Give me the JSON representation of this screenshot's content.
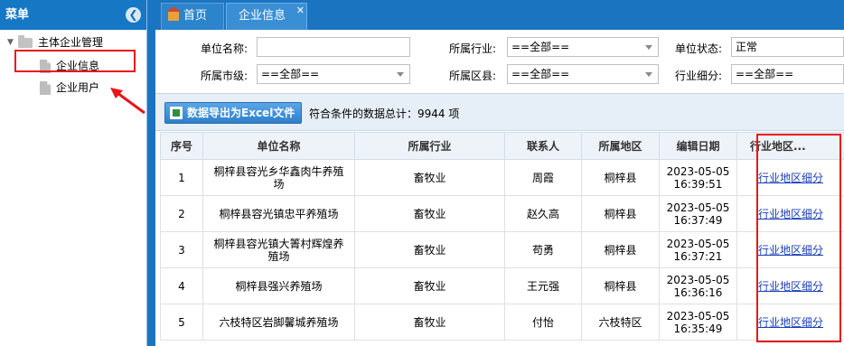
{
  "sidebar": {
    "title": "菜单",
    "collapse_icon": "chevron-left-icon",
    "root_label": "主体企业管理",
    "items": [
      {
        "label": "企业信息"
      },
      {
        "label": "企业用户"
      }
    ]
  },
  "tabs": [
    {
      "label": "首页",
      "icon": "home-icon"
    },
    {
      "label": "企业信息"
    }
  ],
  "form": {
    "unit_name_label": "单位名称:",
    "unit_name_value": "",
    "industry_label": "所属行业:",
    "industry_value": "==全部==",
    "status_label": "单位状态:",
    "status_value": "正常",
    "city_label": "所属市级:",
    "city_value": "==全部==",
    "county_label": "所属区县:",
    "county_value": "==全部==",
    "sub_industry_label": "行业细分:",
    "sub_industry_value": "==全部=="
  },
  "toolbar": {
    "export_label": "数据导出为Excel文件",
    "total_text": "符合条件的数据总计：9944 项"
  },
  "table": {
    "columns": [
      "序号",
      "单位名称",
      "所属行业",
      "联系人",
      "所属地区",
      "编辑日期",
      "行业地区..."
    ],
    "rows": [
      {
        "no": "1",
        "name": "桐梓县容光乡华鑫肉牛养殖场",
        "industry": "畜牧业",
        "contact": "周霞",
        "region": "桐梓县",
        "date": "2023-05-05 16:39:51",
        "link": "行业地区细分"
      },
      {
        "no": "2",
        "name": "桐梓县容光镇忠平养殖场",
        "industry": "畜牧业",
        "contact": "赵久高",
        "region": "桐梓县",
        "date": "2023-05-05 16:37:49",
        "link": "行业地区细分"
      },
      {
        "no": "3",
        "name": "桐梓县容光镇大箐村辉煌养殖场",
        "industry": "畜牧业",
        "contact": "苟勇",
        "region": "桐梓县",
        "date": "2023-05-05 16:37:21",
        "link": "行业地区细分"
      },
      {
        "no": "4",
        "name": "桐梓县强兴养殖场",
        "industry": "畜牧业",
        "contact": "王元强",
        "region": "桐梓县",
        "date": "2023-05-05 16:36:16",
        "link": "行业地区细分"
      },
      {
        "no": "5",
        "name": "六枝特区岩脚馨城养殖场",
        "industry": "畜牧业",
        "contact": "付怡",
        "region": "六枝特区",
        "date": "2023-05-05 16:35:49",
        "link": "行业地区细分"
      }
    ]
  },
  "colors": {
    "header_blue": "#1677c4",
    "highlight_red": "#e8151b",
    "link_blue": "#1a40b8"
  }
}
